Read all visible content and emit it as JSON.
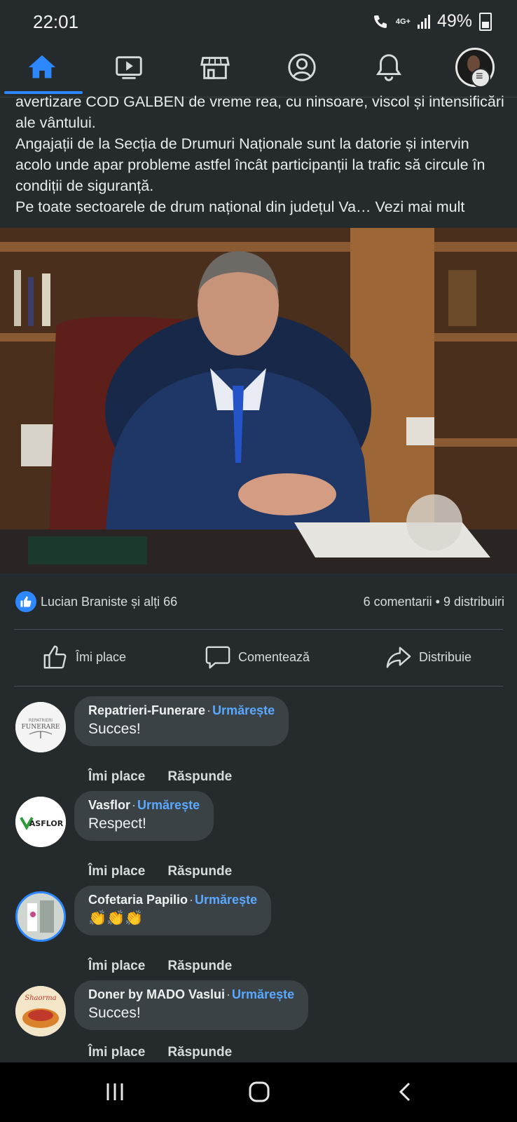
{
  "status_bar": {
    "time": "22:01",
    "network": "4G+",
    "battery": "49%"
  },
  "nav": {
    "icons": [
      "home-icon",
      "video-icon",
      "marketplace-icon",
      "profile-icon",
      "bell-icon",
      "avatar"
    ],
    "accent": "#2d88ff"
  },
  "post": {
    "lines": [
      "avertizare COD GALBEN de vreme rea, cu ninsoare, viscol și intensificări ale vântului.",
      "Angajații de la Secția de Drumuri Naționale sunt la datorie și intervin acolo unde apar probleme astfel încât participanții la trafic să circule în condiții de siguranță.",
      "Pe toate sectoarele de drum național din județul Va…"
    ],
    "see_more": "Vezi mai mult"
  },
  "reactions": {
    "names": "Lucian Braniste și alți 66",
    "comments": "6 comentarii",
    "separator": "•",
    "shares": "9 distribuiri"
  },
  "actions": {
    "like": "Îmi place",
    "comment": "Comentează",
    "share": "Distribuie"
  },
  "comments": [
    {
      "author": "Repatrieri-Funerare",
      "follow": "Urmărește",
      "text": "Succes!",
      "like": "Îmi place",
      "reply": "Răspunde"
    },
    {
      "author": "Vasflor",
      "follow": "Urmărește",
      "text": "Respect!",
      "like": "Îmi place",
      "reply": "Răspunde"
    },
    {
      "author": "Cofetaria Papilio",
      "follow": "Urmărește",
      "text": "👏👏👏",
      "like": "Îmi place",
      "reply": "Răspunde"
    },
    {
      "author": "Doner by MADO Vaslui",
      "follow": "Urmărește",
      "text": "Succes!",
      "like": "Îmi place",
      "reply": "Răspunde"
    }
  ],
  "avatar_labels": {
    "funerare_small": "REPATRIERI",
    "funerare_big": "FUNERARE",
    "vasflor": "ASFLOR",
    "doner": "Shaorma"
  },
  "colors": {
    "background": "#252b2d",
    "bubble": "#3a4245",
    "follow_link": "#5aa8ff"
  }
}
